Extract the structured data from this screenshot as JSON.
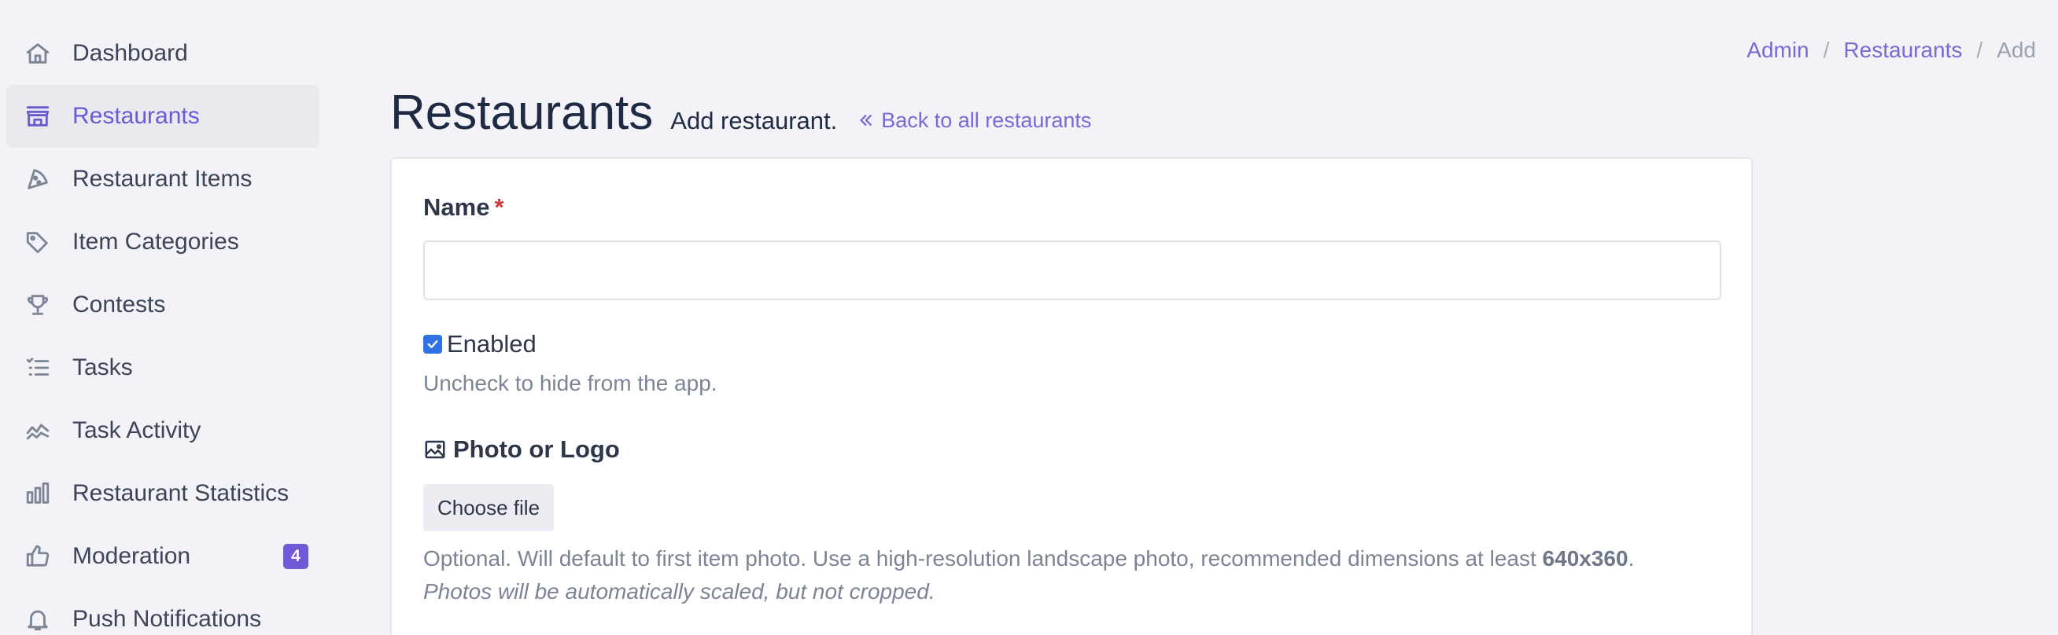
{
  "sidebar": {
    "items": [
      {
        "label": "Dashboard",
        "icon": "home-icon"
      },
      {
        "label": "Restaurants",
        "icon": "store-icon",
        "active": true
      },
      {
        "label": "Restaurant Items",
        "icon": "pizza-icon"
      },
      {
        "label": "Item Categories",
        "icon": "tags-icon"
      },
      {
        "label": "Contests",
        "icon": "trophy-icon"
      },
      {
        "label": "Tasks",
        "icon": "list-check-icon"
      },
      {
        "label": "Task Activity",
        "icon": "activity-icon"
      },
      {
        "label": "Restaurant Statistics",
        "icon": "bar-chart-icon"
      },
      {
        "label": "Moderation",
        "icon": "thumbs-up-icon",
        "badge": "4"
      },
      {
        "label": "Push Notifications",
        "icon": "bell-icon"
      }
    ]
  },
  "breadcrumb": {
    "items": [
      "Admin",
      "Restaurants",
      "Add"
    ],
    "separator": "/"
  },
  "header": {
    "title": "Restaurants",
    "subtitle": "Add restaurant.",
    "back_link": "Back to all restaurants"
  },
  "form": {
    "name_label": "Name",
    "required_marker": "*",
    "name_value": "",
    "enabled_label": "Enabled",
    "enabled_checked": true,
    "enabled_help": "Uncheck to hide from the app.",
    "photo_label": "Photo or Logo",
    "choose_file_label": "Choose file",
    "photo_help_text": "Optional. Will default to first item photo. Use a high-resolution landscape photo, recommended dimensions at least",
    "photo_help_dims": "640x360",
    "photo_help_end": ".",
    "photo_help_note": "Photos will be automatically scaled, but not cropped."
  },
  "colors": {
    "accent": "#6b5bd2",
    "badge": "#7058d6",
    "checkbox": "#2f72e6",
    "required": "#d03b3b",
    "background": "#f2f2f7"
  }
}
